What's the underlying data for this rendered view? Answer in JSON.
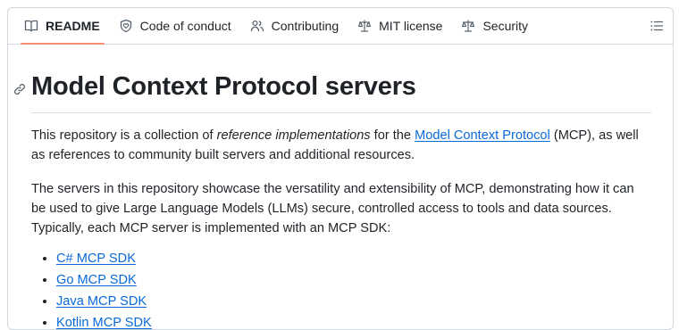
{
  "tabs": [
    {
      "label": "README",
      "icon": "book-icon",
      "active": true
    },
    {
      "label": "Code of conduct",
      "icon": "heart-shield-icon",
      "active": false
    },
    {
      "label": "Contributing",
      "icon": "people-icon",
      "active": false
    },
    {
      "label": "MIT license",
      "icon": "law-scale-icon",
      "active": false
    },
    {
      "label": "Security",
      "icon": "law-scale-icon",
      "active": false
    }
  ],
  "toc_icon": "list-unordered-icon",
  "readme": {
    "title": "Model Context Protocol servers",
    "intro": {
      "before": "This repository is a collection of ",
      "em": "reference implementations",
      "mid": " for the ",
      "link": "Model Context Protocol",
      "after": " (MCP), as well as references to community built servers and additional resources."
    },
    "para2": "The servers in this repository showcase the versatility and extensibility of MCP, demonstrating how it can be used to give Large Language Models (LLMs) secure, controlled access to tools and data sources. Typically, each MCP server is implemented with an MCP SDK:",
    "sdks": [
      "C# MCP SDK",
      "Go MCP SDK",
      "Java MCP SDK",
      "Kotlin MCP SDK"
    ]
  },
  "colors": {
    "accent": "#0969da",
    "active_tab_underline": "#fd8c73",
    "border": "#d0d7de"
  }
}
